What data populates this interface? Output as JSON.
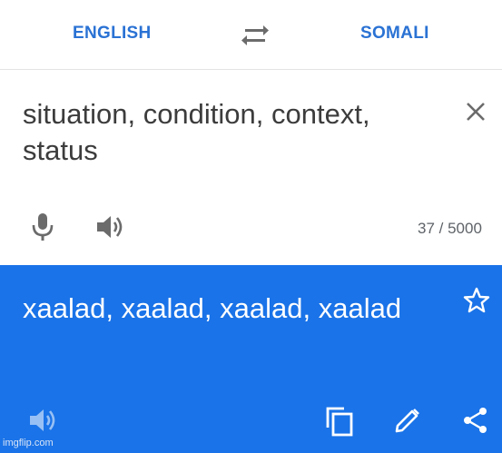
{
  "languages": {
    "source": "ENGLISH",
    "target": "SOMALI"
  },
  "input": {
    "text": "situation, condition, context, status",
    "char_count": "37 / 5000"
  },
  "output": {
    "text": "xaalad, xaalad, xaalad, xaalad"
  },
  "watermark": "imgflip.com",
  "icons": {
    "swap": "swap-arrows-icon",
    "close": "close-icon",
    "mic": "microphone-icon",
    "speaker": "speaker-icon",
    "star": "star-outline-icon",
    "copy": "copy-icon",
    "edit": "pencil-icon",
    "share": "share-icon"
  },
  "colors": {
    "accent": "#1a73e8",
    "language_text": "#2a72d4",
    "icon_gray": "#6b6b6b"
  }
}
